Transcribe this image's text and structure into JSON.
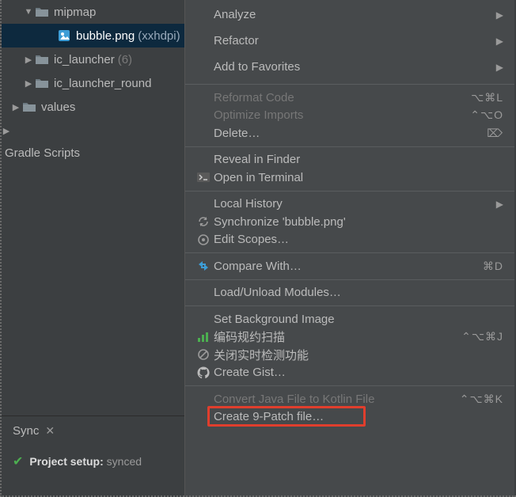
{
  "tree": {
    "items": [
      {
        "indent": 28,
        "arrow": "down",
        "icon": "folder",
        "label": "mipmap",
        "annot": ""
      },
      {
        "indent": 56,
        "arrow": "",
        "icon": "image",
        "label": "bubble.png",
        "annot": "(xxhdpi)",
        "selected": true
      },
      {
        "indent": 28,
        "arrow": "right",
        "icon": "folder",
        "label": "ic_launcher",
        "annot": "(6)"
      },
      {
        "indent": 28,
        "arrow": "right",
        "icon": "folder",
        "label": "ic_launcher_round",
        "annot": ""
      },
      {
        "indent": 12,
        "arrow": "right",
        "icon": "folder",
        "label": "values",
        "annot": ""
      }
    ],
    "root_arrow": "right",
    "gradle_label": "Gradle Scripts"
  },
  "sync": {
    "tab": "Sync",
    "status_label": "Project setup:",
    "status_value": "synced"
  },
  "menu": {
    "groups": [
      [
        {
          "label": "Analyze",
          "submenu": true
        },
        {
          "label": "Refactor",
          "submenu": true
        },
        {
          "label": "Add to Favorites",
          "submenu": true
        }
      ],
      [
        {
          "label": "Reformat Code",
          "shortcut": "⌥⌘L",
          "disabled": true
        },
        {
          "label": "Optimize Imports",
          "shortcut": "⌃⌥O",
          "disabled": true
        },
        {
          "label": "Delete…",
          "shortcut": "⌦"
        }
      ],
      [
        {
          "label": "Reveal in Finder"
        },
        {
          "label": "Open in Terminal",
          "icon": "terminal"
        }
      ],
      [
        {
          "label": "Local History",
          "submenu": true
        },
        {
          "label": "Synchronize 'bubble.png'",
          "icon": "sync"
        },
        {
          "label": "Edit Scopes…",
          "icon": "scope"
        }
      ],
      [
        {
          "label": "Compare With…",
          "icon": "compare",
          "shortcut": "⌘D"
        }
      ],
      [
        {
          "label": "Load/Unload Modules…"
        }
      ],
      [
        {
          "label": "Set Background Image"
        },
        {
          "label": "编码规约扫描",
          "icon": "chart",
          "shortcut": "⌃⌥⌘J"
        },
        {
          "label": "关闭实时检测功能",
          "icon": "cancel"
        },
        {
          "label": "Create Gist…",
          "icon": "github"
        }
      ],
      [
        {
          "label": "Convert Java File to Kotlin File",
          "shortcut": "⌃⌥⌘K",
          "disabled": true
        },
        {
          "label": "Create 9-Patch file…",
          "highlight": true
        }
      ]
    ]
  }
}
